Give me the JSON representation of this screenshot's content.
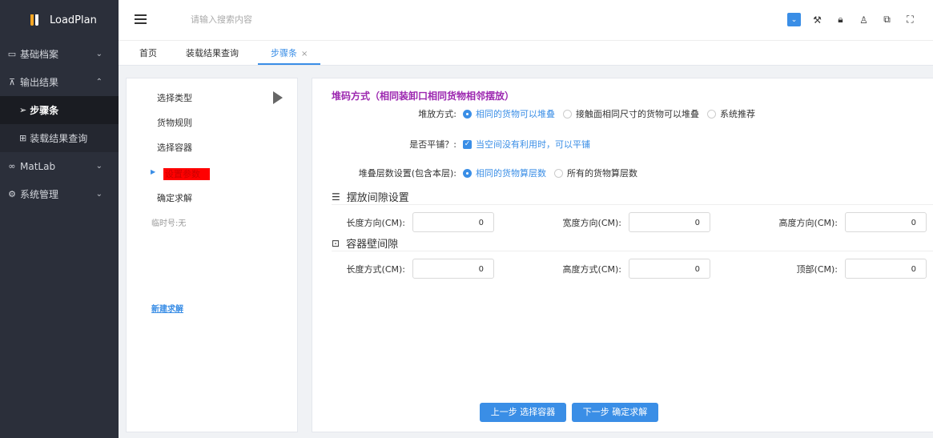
{
  "app": {
    "name": "LoadPlan"
  },
  "sidebar": {
    "items": [
      {
        "label": "基础档案",
        "icon": "id-card-icon"
      },
      {
        "label": "输出结果",
        "icon": "pin-icon"
      },
      {
        "label": "步骤条",
        "icon": "send-icon"
      },
      {
        "label": "装载结果查询",
        "icon": "table-icon"
      },
      {
        "label": "MatLab",
        "icon": "infinity-icon"
      },
      {
        "label": "系统管理",
        "icon": "gear-icon"
      }
    ]
  },
  "header": {
    "search_placeholder": "请输入搜索内容"
  },
  "tabs": [
    {
      "label": "首页"
    },
    {
      "label": "装载结果查询"
    },
    {
      "label": "步骤条"
    }
  ],
  "steps": {
    "items": [
      "选择类型",
      "货物规则",
      "选择容器",
      "设置参数",
      "确定求解"
    ],
    "current_index": 3,
    "temp": "临时号:无",
    "new_link": "新建求解"
  },
  "content": {
    "title": "堆码方式（相同装卸口相同货物相邻摆放）",
    "stack_mode": {
      "label": "堆放方式:",
      "options": [
        "相同的货物可以堆叠",
        "接触面相同尺寸的货物可以堆叠",
        "系统推荐"
      ],
      "selected": 0
    },
    "flat": {
      "label": "是否平铺？:",
      "check_label": "当空间没有利用时，可以平铺",
      "checked": true
    },
    "layers": {
      "label": "堆叠层数设置(包含本层):",
      "options": [
        "相同的货物算层数",
        "所有的货物算层数"
      ],
      "selected": 0
    },
    "gap_section": {
      "title": "摆放间隙设置",
      "fields": [
        {
          "label": "长度方向(CM):",
          "value": "0"
        },
        {
          "label": "宽度方向(CM):",
          "value": "0"
        },
        {
          "label": "高度方向(CM):",
          "value": "0"
        }
      ]
    },
    "wall_section": {
      "title": "容器壁间隙",
      "fields": [
        {
          "label": "长度方式(CM):",
          "value": "0"
        },
        {
          "label": "高度方式(CM):",
          "value": "0"
        },
        {
          "label": "顶部(CM):",
          "value": "0"
        }
      ]
    },
    "buttons": {
      "prev": "上一步 选择容器",
      "next": "下一步 确定求解"
    }
  }
}
